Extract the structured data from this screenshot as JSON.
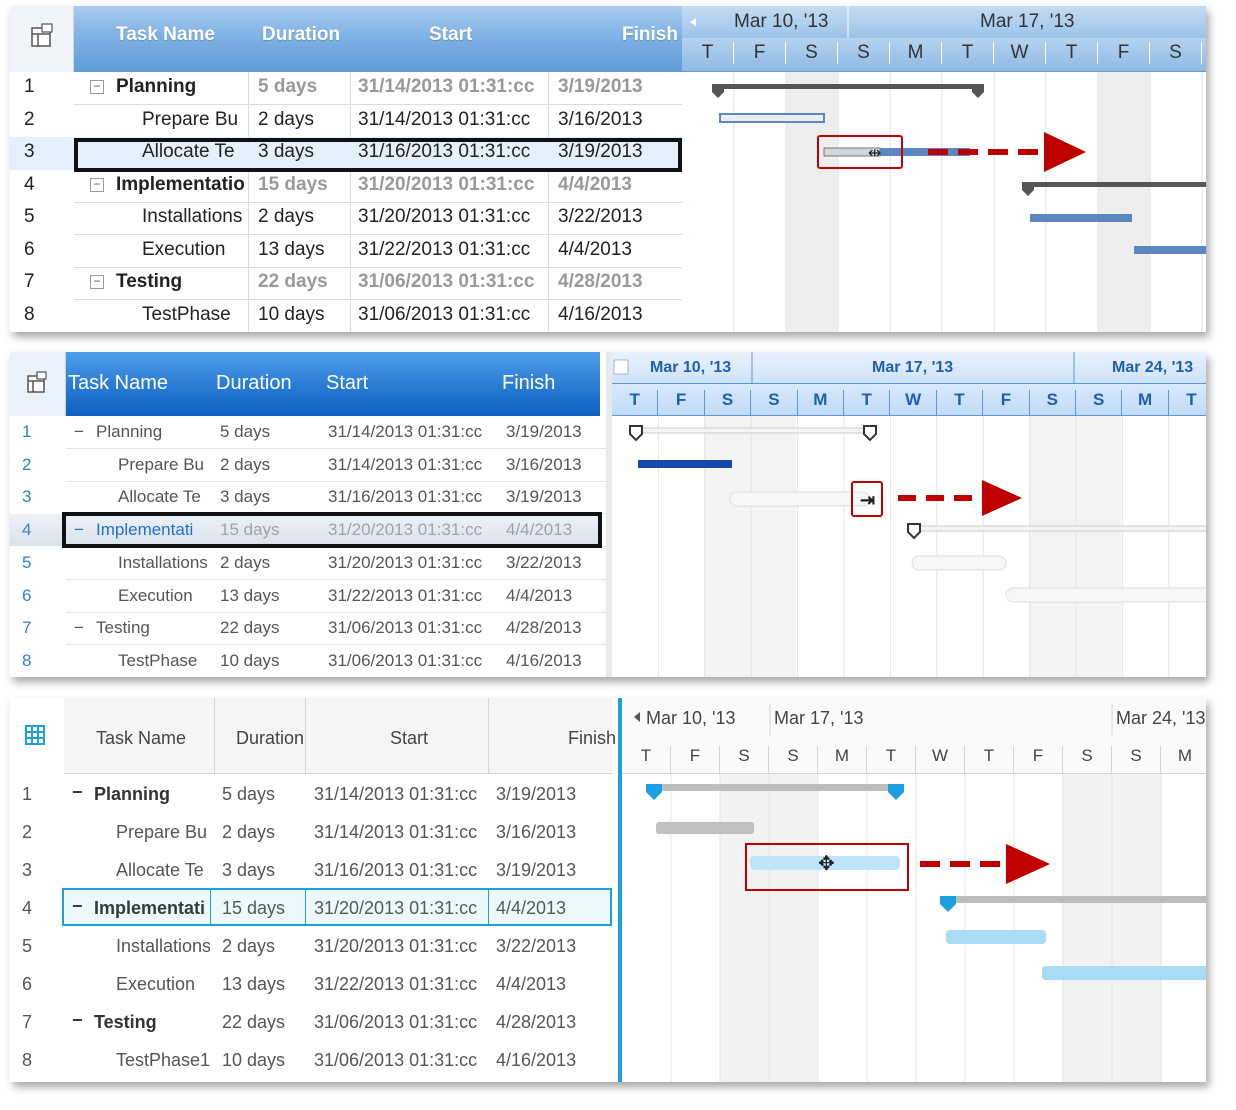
{
  "panel1": {
    "columns": [
      "Task Name",
      "Duration",
      "Start",
      "Finish"
    ],
    "timeline_weeks": [
      "Mar 10, '13",
      "Mar 17, '13"
    ],
    "days": [
      "T",
      "F",
      "S",
      "S",
      "M",
      "T",
      "W",
      "T",
      "F",
      "S"
    ],
    "rows": [
      {
        "num": "1",
        "toggle": "−",
        "name": "Planning",
        "duration": "5 days",
        "start": "31/14/2013 01:31:cc",
        "finish": "3/19/2013"
      },
      {
        "num": "2",
        "toggle": "",
        "name": "Prepare Bu",
        "duration": "2 days",
        "start": "31/14/2013 01:31:cc",
        "finish": "3/16/2013"
      },
      {
        "num": "3",
        "toggle": "",
        "name": "Allocate Te",
        "duration": "3 days",
        "start": "31/16/2013 01:31:cc",
        "finish": "3/19/2013"
      },
      {
        "num": "4",
        "toggle": "−",
        "name": "Implementatio",
        "duration": "15 days",
        "start": "31/20/2013 01:31:cc",
        "finish": "4/4/2013"
      },
      {
        "num": "5",
        "toggle": "",
        "name": "Installations",
        "duration": "2 days",
        "start": "31/20/2013 01:31:cc",
        "finish": "3/22/2013"
      },
      {
        "num": "6",
        "toggle": "",
        "name": "Execution",
        "duration": "13 days",
        "start": "31/22/2013 01:31:cc",
        "finish": "4/4/2013"
      },
      {
        "num": "7",
        "toggle": "−",
        "name": "Testing",
        "duration": "22 days",
        "start": "31/06/2013 01:31:cc",
        "finish": "4/28/2013"
      },
      {
        "num": "8",
        "toggle": "",
        "name": "TestPhase",
        "duration": "10 days",
        "start": "31/06/2013 01:31:cc",
        "finish": "4/16/2013"
      }
    ]
  },
  "panel2": {
    "columns": [
      "Task Name",
      "Duration",
      "Start",
      "Finish"
    ],
    "timeline_weeks": [
      "Mar 10, '13",
      "Mar 17, '13",
      "Mar 24, '13"
    ],
    "days": [
      "T",
      "F",
      "S",
      "S",
      "M",
      "T",
      "W",
      "T",
      "F",
      "S",
      "S",
      "M",
      "T"
    ],
    "rows": [
      {
        "num": "1",
        "toggle": "−",
        "name": "Planning",
        "duration": "5 days",
        "start": "31/14/2013 01:31:cc",
        "finish": "3/19/2013"
      },
      {
        "num": "2",
        "toggle": "",
        "name": "Prepare Bu",
        "duration": "2 days",
        "start": "31/14/2013 01:31:cc",
        "finish": "3/16/2013"
      },
      {
        "num": "3",
        "toggle": "",
        "name": "Allocate Te",
        "duration": "3 days",
        "start": "31/16/2013 01:31:cc",
        "finish": "3/19/2013"
      },
      {
        "num": "4",
        "toggle": "−",
        "name": "Implementati",
        "duration": "15 days",
        "start": "31/20/2013 01:31:cc",
        "finish": "4/4/2013"
      },
      {
        "num": "5",
        "toggle": "",
        "name": "Installations",
        "duration": "2 days",
        "start": "31/20/2013 01:31:cc",
        "finish": "3/22/2013"
      },
      {
        "num": "6",
        "toggle": "",
        "name": "Execution",
        "duration": "13 days",
        "start": "31/22/2013 01:31:cc",
        "finish": "4/4/2013"
      },
      {
        "num": "7",
        "toggle": "−",
        "name": "Testing",
        "duration": "22 days",
        "start": "31/06/2013 01:31:cc",
        "finish": "4/28/2013"
      },
      {
        "num": "8",
        "toggle": "",
        "name": "TestPhase",
        "duration": "10 days",
        "start": "31/06/2013 01:31:cc",
        "finish": "4/16/2013"
      }
    ]
  },
  "panel3": {
    "columns": [
      "Task Name",
      "Duration",
      "Start",
      "Finish"
    ],
    "timeline_weeks": [
      "Mar 10, '13",
      "Mar 17, '13",
      "Mar 24, '13"
    ],
    "days": [
      "T",
      "F",
      "S",
      "S",
      "M",
      "T",
      "W",
      "T",
      "F",
      "S",
      "S",
      "M"
    ],
    "rows": [
      {
        "num": "1",
        "toggle": "−",
        "name": "Planning",
        "duration": "5 days",
        "start": "31/14/2013 01:31:cc",
        "finish": "3/19/2013"
      },
      {
        "num": "2",
        "toggle": "",
        "name": "Prepare Bu",
        "duration": "2 days",
        "start": "31/14/2013 01:31:cc",
        "finish": "3/16/2013"
      },
      {
        "num": "3",
        "toggle": "",
        "name": "Allocate Te",
        "duration": "3 days",
        "start": "31/16/2013 01:31:cc",
        "finish": "3/19/2013"
      },
      {
        "num": "4",
        "toggle": "−",
        "name": "Implementati",
        "duration": "15 days",
        "start": "31/20/2013 01:31:cc",
        "finish": "4/4/2013"
      },
      {
        "num": "5",
        "toggle": "",
        "name": "Installations",
        "duration": "2 days",
        "start": "31/20/2013 01:31:cc",
        "finish": "3/22/2013"
      },
      {
        "num": "6",
        "toggle": "",
        "name": "Execution",
        "duration": "13 days",
        "start": "31/22/2013 01:31:cc",
        "finish": "4/4/2013"
      },
      {
        "num": "7",
        "toggle": "−",
        "name": "Testing",
        "duration": "22 days",
        "start": "31/06/2013 01:31:cc",
        "finish": "4/28/2013"
      },
      {
        "num": "8",
        "toggle": "",
        "name": "TestPhase1",
        "duration": "10 days",
        "start": "31/06/2013 01:31:cc",
        "finish": "4/16/2013"
      }
    ]
  },
  "colors": {
    "arrow_red": "#c00000",
    "office_header": "#6fa7e0",
    "office2013_header": "#1f6fcf",
    "metro_accent": "#1ba1e2"
  },
  "icons": {
    "corner": "column-chooser-icon",
    "move": "move-cursor-icon",
    "resize": "resize-cursor-icon"
  }
}
